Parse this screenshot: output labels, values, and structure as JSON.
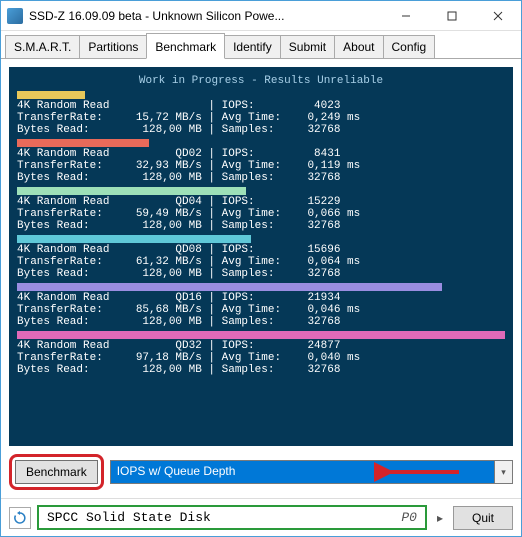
{
  "window": {
    "title": "SSD-Z 16.09.09 beta - Unknown Silicon Powe..."
  },
  "tabs": [
    {
      "label": "S.M.A.R.T.",
      "active": false
    },
    {
      "label": "Partitions",
      "active": false
    },
    {
      "label": "Benchmark",
      "active": true
    },
    {
      "label": "Identify",
      "active": false
    },
    {
      "label": "Submit",
      "active": false
    },
    {
      "label": "About",
      "active": false
    },
    {
      "label": "Config",
      "active": false
    }
  ],
  "bench": {
    "header": "Work in Progress - Results Unreliable",
    "blocks": [
      {
        "bar_color": "#e8c85a",
        "bar_pct": 14,
        "qd": "",
        "l1": "4K Random Read",
        "l2": "TransferRate:",
        "l2v": "15,72 MB/s",
        "l3": "Bytes Read:",
        "l3v": "128,00 MB",
        "iops": "4023",
        "avg": "0,249 ms",
        "samp": "32768"
      },
      {
        "bar_color": "#e86a5a",
        "bar_pct": 27,
        "qd": "QD02",
        "l1": "4K Random Read",
        "l2": "TransferRate:",
        "l2v": "32,93 MB/s",
        "l3": "Bytes Read:",
        "l3v": "128,00 MB",
        "iops": "8431",
        "avg": "0,119 ms",
        "samp": "32768"
      },
      {
        "bar_color": "#9de0b8",
        "bar_pct": 47,
        "qd": "QD04",
        "l1": "4K Random Read",
        "l2": "TransferRate:",
        "l2v": "59,49 MB/s",
        "l3": "Bytes Read:",
        "l3v": "128,00 MB",
        "iops": "15229",
        "avg": "0,066 ms",
        "samp": "32768"
      },
      {
        "bar_color": "#5fc8d8",
        "bar_pct": 48,
        "qd": "QD08",
        "l1": "4K Random Read",
        "l2": "TransferRate:",
        "l2v": "61,32 MB/s",
        "l3": "Bytes Read:",
        "l3v": "128,00 MB",
        "iops": "15696",
        "avg": "0,064 ms",
        "samp": "32768"
      },
      {
        "bar_color": "#9a8de0",
        "bar_pct": 87,
        "qd": "QD16",
        "l1": "4K Random Read",
        "l2": "TransferRate:",
        "l2v": "85,68 MB/s",
        "l3": "Bytes Read:",
        "l3v": "128,00 MB",
        "iops": "21934",
        "avg": "0,046 ms",
        "samp": "32768"
      },
      {
        "bar_color": "#e06ab8",
        "bar_pct": 100,
        "qd": "QD32",
        "l1": "4K Random Read",
        "l2": "TransferRate:",
        "l2v": "97,18 MB/s",
        "l3": "Bytes Read:",
        "l3v": "128,00 MB",
        "iops": "24877",
        "avg": "0,040 ms",
        "samp": "32768"
      }
    ]
  },
  "controls": {
    "bench_button": "Benchmark",
    "dropdown_selected": "IOPS w/ Queue Depth"
  },
  "status": {
    "disk": "SPCC Solid State Disk",
    "port": "P0",
    "quit": "Quit"
  }
}
